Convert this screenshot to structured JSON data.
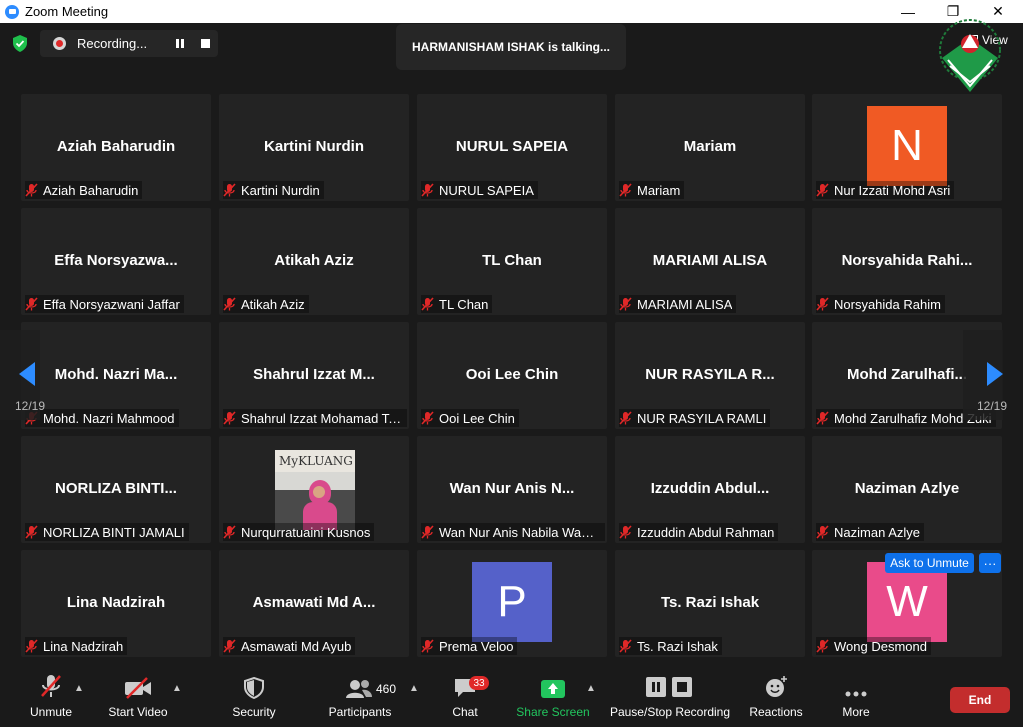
{
  "window": {
    "title": "Zoom Meeting",
    "minimize": "—",
    "maximize": "❐",
    "close": "✕"
  },
  "topbar": {
    "recording_label": "Recording...",
    "talking_label": "HARMANISHAM ISHAK is talking...",
    "view_label": "View"
  },
  "grid": {
    "page_left": "12/19",
    "page_right": "12/19",
    "tiles": [
      {
        "display": "Aziah Baharudin",
        "footer": "Aziah Baharudin"
      },
      {
        "display": "Kartini Nurdin",
        "footer": "Kartini Nurdin"
      },
      {
        "display": "NURUL SAPEIA",
        "footer": "NURUL SAPEIA"
      },
      {
        "display": "Mariam",
        "footer": "Mariam"
      },
      {
        "display": "",
        "footer": "Nur Izzati Mohd Asri",
        "avatar": "N",
        "avatar_color": "#f05a24"
      },
      {
        "display": "Effa Norsyazwa...",
        "footer": "Effa Norsyazwani Jaffar"
      },
      {
        "display": "Atikah Aziz",
        "footer": "Atikah Aziz"
      },
      {
        "display": "TL Chan",
        "footer": "TL Chan"
      },
      {
        "display": "MARIAMI ALISA",
        "footer": "MARIAMI ALISA"
      },
      {
        "display": "Norsyahida Rahi...",
        "footer": "Norsyahida Rahim"
      },
      {
        "display": "Mohd. Nazri Ma...",
        "footer": "Mohd. Nazri Mahmood"
      },
      {
        "display": "Shahrul Izzat M...",
        "footer": "Shahrul Izzat Mohamad Te..."
      },
      {
        "display": "Ooi Lee Chin",
        "footer": "Ooi Lee Chin"
      },
      {
        "display": "NUR RASYILA R...",
        "footer": "NUR RASYILA RAMLI"
      },
      {
        "display": "Mohd Zarulhafi...",
        "footer": "Mohd Zarulhafiz Mohd Zuki"
      },
      {
        "display": "NORLIZA BINTI...",
        "footer": "NORLIZA BINTI JAMALI"
      },
      {
        "display": "",
        "footer": "Nurqurratuaini Kusnos",
        "photo": true,
        "photo_text": "MyKLUANG"
      },
      {
        "display": "Wan Nur Anis N...",
        "footer": "Wan Nur Anis Nabila Wan ..."
      },
      {
        "display": "Izzuddin Abdul...",
        "footer": "Izzuddin Abdul Rahman"
      },
      {
        "display": "Naziman Azlye",
        "footer": "Naziman Azlye"
      },
      {
        "display": "Lina Nadzirah",
        "footer": "Lina Nadzirah"
      },
      {
        "display": "Asmawati Md A...",
        "footer": "Asmawati Md Ayub"
      },
      {
        "display": "",
        "footer": "Prema Veloo",
        "avatar": "P",
        "avatar_color": "#5561c9"
      },
      {
        "display": "Ts. Razi Ishak",
        "footer": "Ts. Razi Ishak"
      },
      {
        "display": "",
        "footer": "Wong Desmond",
        "avatar": "W",
        "avatar_color": "#e94b8a"
      }
    ],
    "ask_to_unmute": "Ask to Unmute",
    "more_dots": "···"
  },
  "toolbar": {
    "unmute": "Unmute",
    "start_video": "Start Video",
    "security": "Security",
    "participants": "Participants",
    "participant_count": "460",
    "chat": "Chat",
    "chat_badge": "33",
    "share_screen": "Share Screen",
    "pause_stop_recording": "Pause/Stop Recording",
    "reactions": "Reactions",
    "more": "More",
    "end": "End"
  },
  "colors": {
    "share_green": "#22c55e",
    "end_red": "#c32d2d",
    "accent_blue": "#0e71eb",
    "tile_bg": "#232323"
  }
}
